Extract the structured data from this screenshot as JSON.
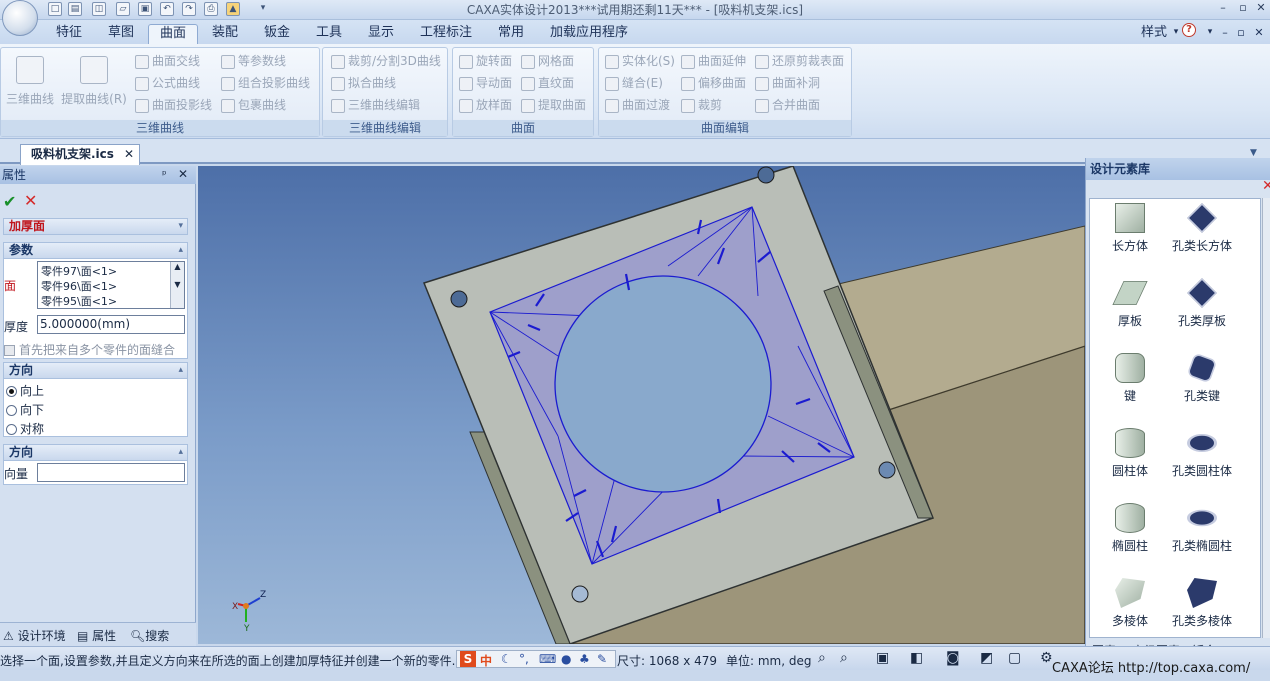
{
  "app": {
    "title": "CAXA实体设计2013***试用期还剩11天*** - [吸料机支架.ics]",
    "style_label": "样式"
  },
  "ribbon_tabs": [
    "特征",
    "草图",
    "曲面",
    "装配",
    "钣金",
    "工具",
    "显示",
    "工程标注",
    "常用",
    "加载应用程序"
  ],
  "active_tab": "曲面",
  "groups": {
    "curves3d": {
      "label": "三维曲线",
      "big": [
        "三维曲线",
        "提取曲线(R)"
      ],
      "small": [
        "曲面交线",
        "公式曲线",
        "曲面投影线",
        "等参数线",
        "组合投影曲线",
        "包裹曲线"
      ]
    },
    "edit3d": {
      "label": "三维曲线编辑",
      "small": [
        "裁剪/分割3D曲线",
        "拟合曲线",
        "三维曲线编辑"
      ]
    },
    "surface": {
      "label": "曲面",
      "small": [
        "旋转面",
        "导动面",
        "放样面",
        "网格面",
        "直纹面",
        "提取曲面"
      ]
    },
    "surfedit": {
      "label": "曲面编辑",
      "small": [
        "实体化(S)",
        "缝合(E)",
        "曲面过渡",
        "曲面延伸",
        "偏移曲面",
        "裁剪",
        "还原剪裁表面",
        "曲面补洞",
        "合并曲面"
      ]
    }
  },
  "document_tab": "吸料机支架.ics",
  "property_panel": {
    "title": "属性",
    "feature": "加厚面",
    "params_header": "参数",
    "face_label": "面",
    "faces": [
      "零件97\\面<1>",
      "零件96\\面<1>",
      "零件95\\面<1>"
    ],
    "thickness_label": "厚度",
    "thickness_value": "5.000000(mm)",
    "stitch_label": "首先把来自多个零件的面缝合",
    "direction_header": "方向",
    "dir_options": [
      "向上",
      "向下",
      "对称"
    ],
    "direction2_header": "方向",
    "vector_label": "向量",
    "vector_value": ""
  },
  "bottom_tabs": [
    "设计环境",
    "属性",
    "搜索"
  ],
  "library": {
    "title": "设计元素库",
    "items": [
      "长方体",
      "孔类长方体",
      "厚板",
      "孔类厚板",
      "键",
      "孔类键",
      "圆柱体",
      "孔类圆柱体",
      "椭圆柱",
      "孔类椭圆柱",
      "多棱体",
      "孔类多棱体"
    ],
    "tabs": [
      "图素",
      "高级图素",
      "钣金"
    ]
  },
  "status": {
    "hint": "选择一个面,设置参数,并且定义方向来在所选的面上创建加厚特征并创建一个新的零件.",
    "size": "尺寸: 1068 x 479",
    "units": "单位: mm, deg",
    "watermark": "CAXA论坛 http://top.caxa.com/",
    "ime_s": "S",
    "ime_zh": "中"
  },
  "axes": {
    "z": "Z",
    "x": "X",
    "y": "Y"
  }
}
